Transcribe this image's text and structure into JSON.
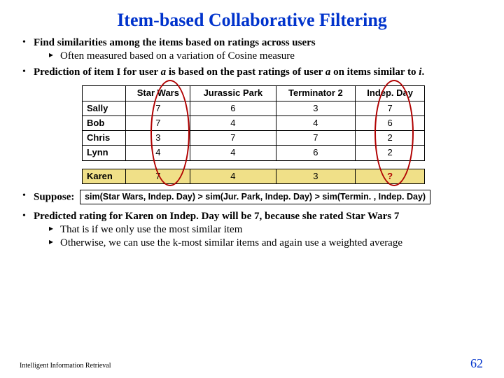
{
  "title": "Item-based Collaborative Filtering",
  "b1_text": "Find similarities among the items based on ratings across users",
  "b1_sub1": "Often measured based on a variation of Cosine measure",
  "b2_prefix": "Prediction of item I for user ",
  "b2_a1": "a",
  "b2_mid": " is based on the past ratings of user ",
  "b2_a2": "a",
  "b2_mid2": " on items similar to ",
  "b2_i": "i",
  "b2_suffix": ".",
  "table": {
    "cols": [
      "",
      "Star Wars",
      "Jurassic Park",
      "Terminator 2",
      "Indep. Day"
    ],
    "rows": [
      {
        "name": "Sally",
        "v": [
          "7",
          "6",
          "3",
          "7"
        ]
      },
      {
        "name": "Bob",
        "v": [
          "7",
          "4",
          "4",
          "6"
        ]
      },
      {
        "name": "Chris",
        "v": [
          "3",
          "7",
          "7",
          "2"
        ]
      },
      {
        "name": "Lynn",
        "v": [
          "4",
          "4",
          "6",
          "2"
        ]
      }
    ],
    "karen": {
      "name": "Karen",
      "v": [
        "7",
        "4",
        "3",
        "?"
      ]
    }
  },
  "suppose_label": "Suppose:",
  "suppose_box": "sim(Star Wars, Indep. Day) > sim(Jur. Park, Indep. Day) > sim(Termin. , Indep. Day)",
  "b4_text": "Predicted rating for Karen on Indep. Day will be 7, because she rated Star Wars 7",
  "b4_sub1": "That is if we only use the most similar item",
  "b4_sub2": "Otherwise, we can use the k-most similar items and again use a weighted average",
  "footer_left": "Intelligent Information Retrieval",
  "footer_right": "62"
}
